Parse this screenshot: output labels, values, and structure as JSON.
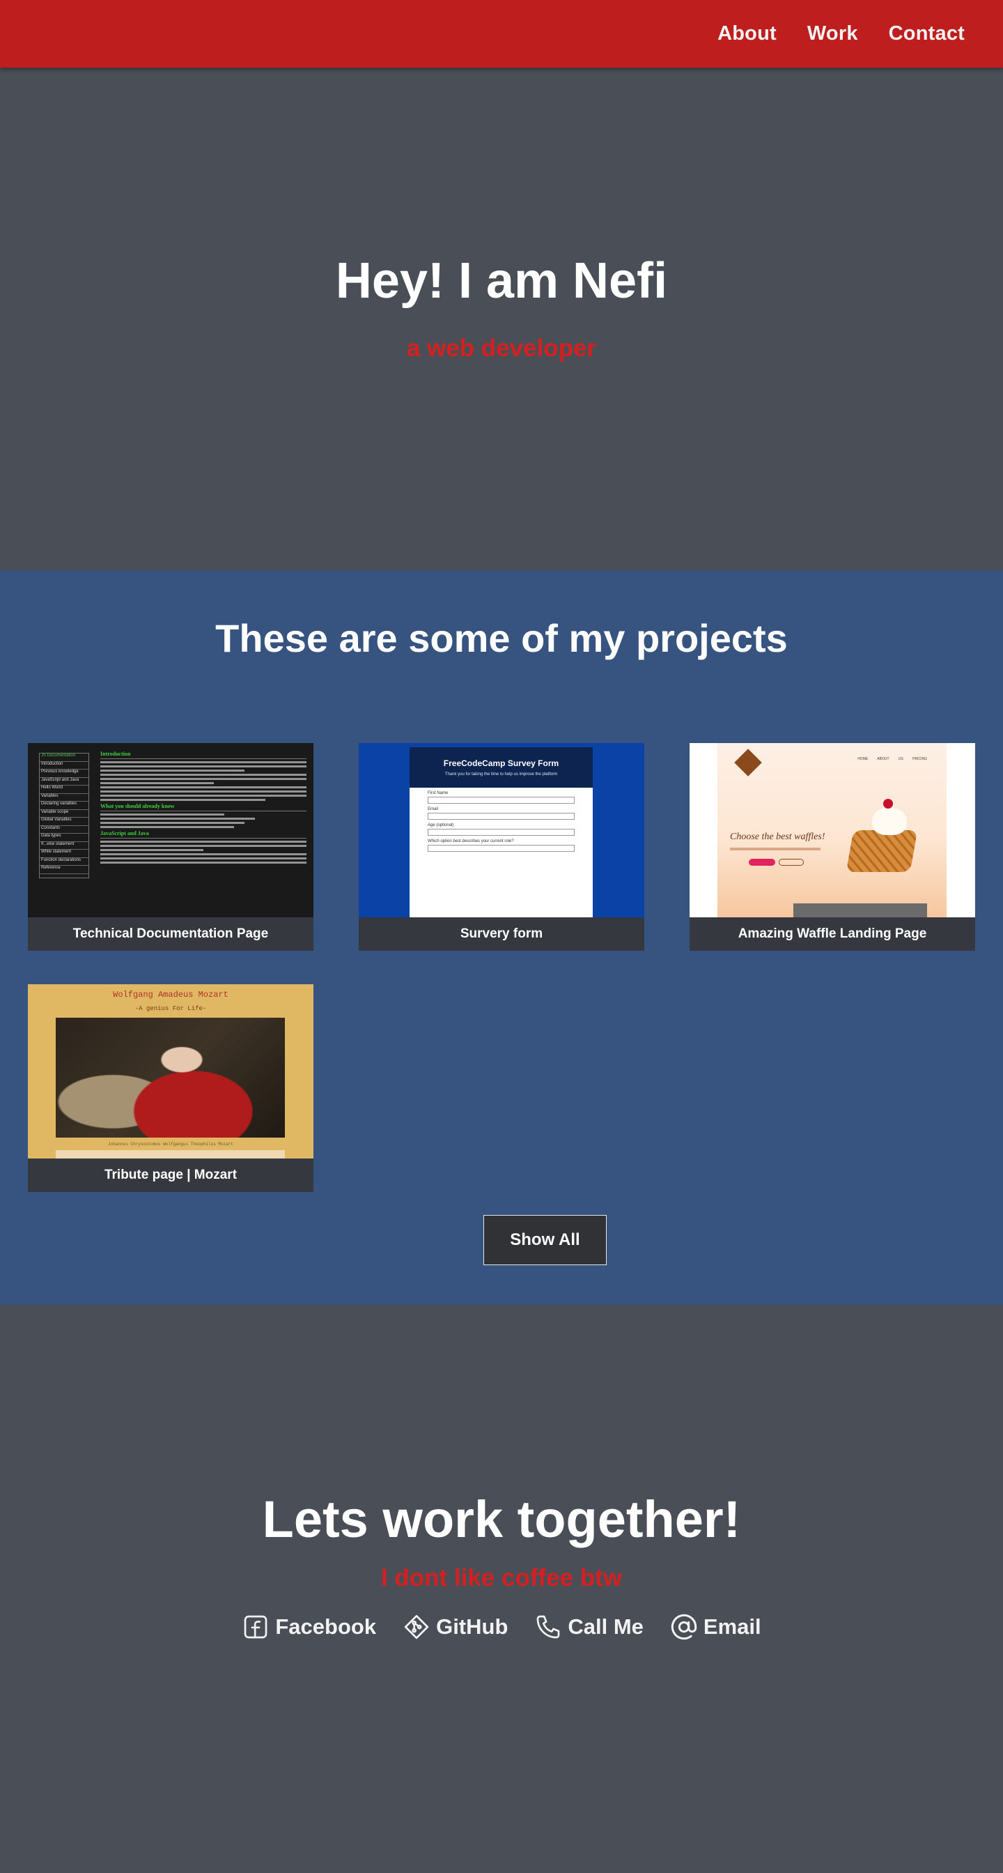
{
  "nav": {
    "items": [
      "About",
      "Work",
      "Contact"
    ]
  },
  "hero": {
    "title": "Hey! I am Nefi",
    "subtitle": "a web developer"
  },
  "projects": {
    "heading": "These are some of my projects",
    "cards": [
      {
        "title": "Technical Documentation Page",
        "thumb_heading": "JS Documentation",
        "thumb_nav": [
          "JS Documentation",
          "Introduction",
          "Previous knowledge",
          "JavaScript and Java",
          "Hello World",
          "Variables",
          "Declaring variables",
          "Variable scope",
          "Global Variables",
          "Constants",
          "Data types",
          "If...else statement",
          "While statement",
          "Function declarations",
          "Reference"
        ],
        "thumb_sections": [
          "Introduction",
          "What you should already know",
          "JavaScript and Java"
        ]
      },
      {
        "title": "Survery form",
        "thumb_heading": "FreeCodeCamp Survey Form",
        "thumb_sub": "Thank you for taking the time to help us improve the platform",
        "thumb_fields": [
          "First Name",
          "Email",
          "Age (optional)",
          "Which option best describes your current role?"
        ]
      },
      {
        "title": "Amazing Waffle Landing Page",
        "thumb_heading": "Choose the best waffles!",
        "thumb_menu": "HOME ABOUT US PRICING"
      },
      {
        "title": "Tribute page | Mozart",
        "thumb_heading": "Wolfgang Amadeus Mozart",
        "thumb_sub": "-A genius For Life-",
        "thumb_caption": "Johannes Chrysostomus Wolfgangus Theophilus Mozart"
      }
    ],
    "show_all": "Show All"
  },
  "contact": {
    "heading": "Lets work together!",
    "tagline": "I dont like coffee btw",
    "links": [
      {
        "label": "Facebook",
        "icon": "facebook-icon"
      },
      {
        "label": "GitHub",
        "icon": "github-icon"
      },
      {
        "label": "Call Me",
        "icon": "phone-icon"
      },
      {
        "label": "Email",
        "icon": "at-icon"
      }
    ]
  },
  "colors": {
    "nav_bg": "#be1e1e",
    "hero_bg": "#4a4f57",
    "projects_bg": "#36547f",
    "accent_red": "#d42020",
    "card_bg": "#303236"
  }
}
